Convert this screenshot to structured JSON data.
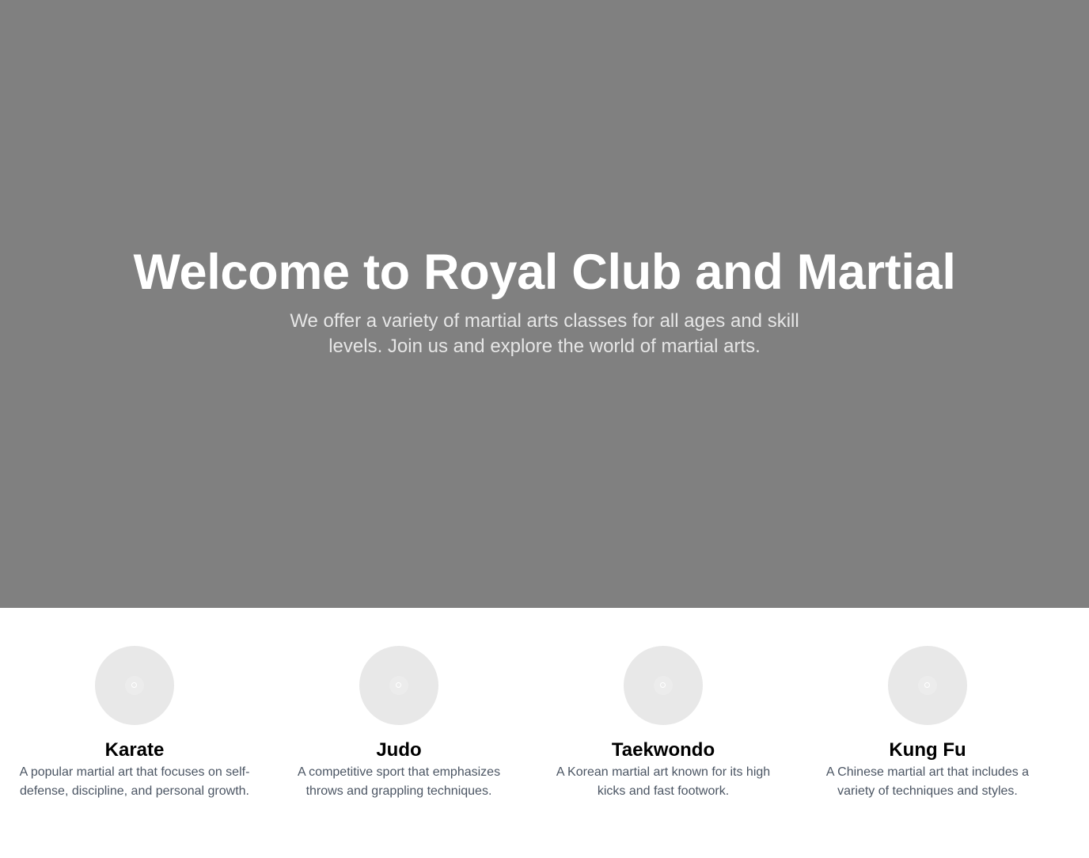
{
  "hero": {
    "title": "Welcome to Royal Club and Martial",
    "subtitle": "We offer a variety of martial arts classes for all ages and skill levels. Join us and explore the world of martial arts."
  },
  "features": [
    {
      "title": "Karate",
      "description": "A popular martial art that focuses on self-defense, discipline, and personal growth."
    },
    {
      "title": "Judo",
      "description": "A competitive sport that emphasizes throws and grappling techniques."
    },
    {
      "title": "Taekwondo",
      "description": "A Korean martial art known for its high kicks and fast footwork."
    },
    {
      "title": "Kung Fu",
      "description": "A Chinese martial art that includes a variety of techniques and styles."
    }
  ],
  "colors": {
    "hero_background": "#808080",
    "hero_title": "#ffffff",
    "hero_subtitle": "#e6e6e6",
    "feature_title": "#000000",
    "feature_description": "#4b5563",
    "image_placeholder": "#e8e8e8"
  },
  "icons": {
    "feature_image": "image-placeholder-icon"
  }
}
